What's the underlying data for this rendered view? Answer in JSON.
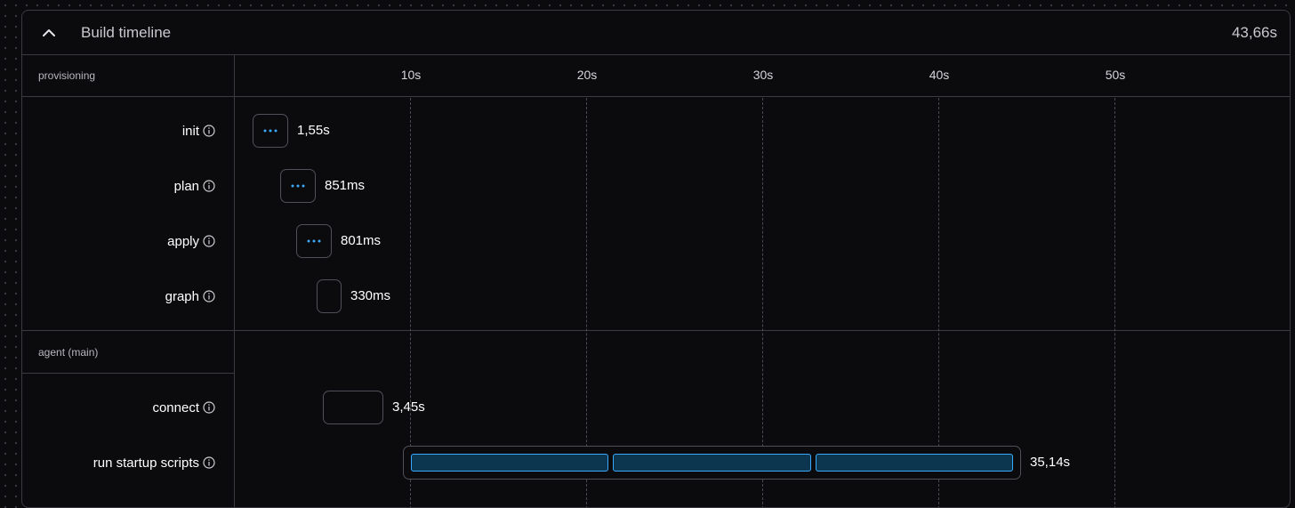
{
  "header": {
    "title": "Build timeline",
    "total_duration": "43,66s",
    "collapse_icon": "chevron-up-icon"
  },
  "axis": {
    "ticks": [
      "10s",
      "20s",
      "30s",
      "40s",
      "50s"
    ]
  },
  "groups": [
    {
      "name": "provisioning",
      "rows": [
        {
          "label": "init",
          "duration": "1,55s"
        },
        {
          "label": "plan",
          "duration": "851ms"
        },
        {
          "label": "apply",
          "duration": "801ms"
        },
        {
          "label": "graph",
          "duration": "330ms"
        }
      ]
    },
    {
      "name": "agent (main)",
      "rows": [
        {
          "label": "connect",
          "duration": "3,45s"
        },
        {
          "label": "run startup scripts",
          "duration": "35,14s"
        }
      ]
    }
  ],
  "colors": {
    "accent": "#3aa9ff",
    "segment_fill": "#0c3650",
    "border": "#3a3a3f",
    "background": "#0b0b0d"
  },
  "icons": {
    "info": "info-icon",
    "pending": "ellipsis-icon"
  }
}
